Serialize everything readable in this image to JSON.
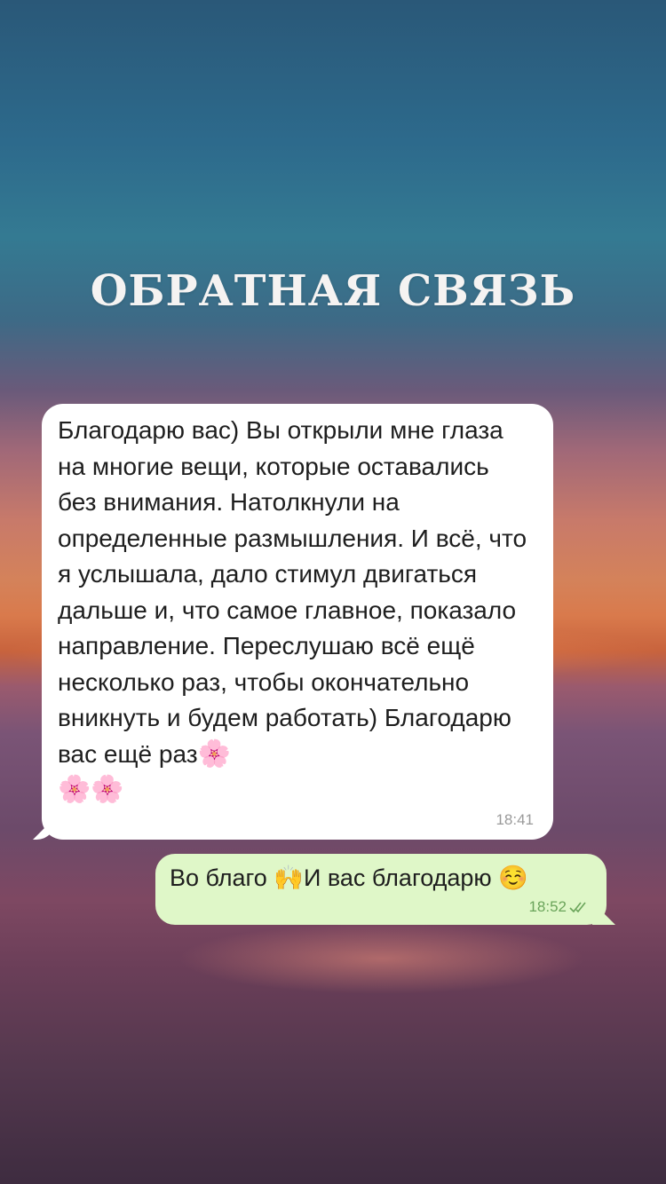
{
  "title": "ОБРАТНАЯ СВЯЗЬ",
  "messages": {
    "incoming": {
      "text": "Благодарю вас) Вы открыли мне глаза на многие вещи, которые оставались без внимания. Натолкнули на определенные размышления. И всё, что я услышала, дало стимул двигаться дальше и, что самое главное, показало направление. Переслушаю всё ещё несколько раз, чтобы окончательно вникнуть и будем работать) Благодарю вас ещё раз",
      "emoji_end": "🌸",
      "emoji_line2": "🌸🌸",
      "time": "18:41"
    },
    "outgoing": {
      "text_part1": "Во благо ",
      "emoji_hands": "🙌",
      "text_part2": "И вас благодарю ",
      "emoji_smile": "☺️",
      "time": "18:52",
      "status_icon": "double-check-icon",
      "status_color": "#6aa45a"
    }
  },
  "colors": {
    "incoming_bubble": "#ffffff",
    "outgoing_bubble": "#dff7c8",
    "title": "#f5f3f2"
  }
}
